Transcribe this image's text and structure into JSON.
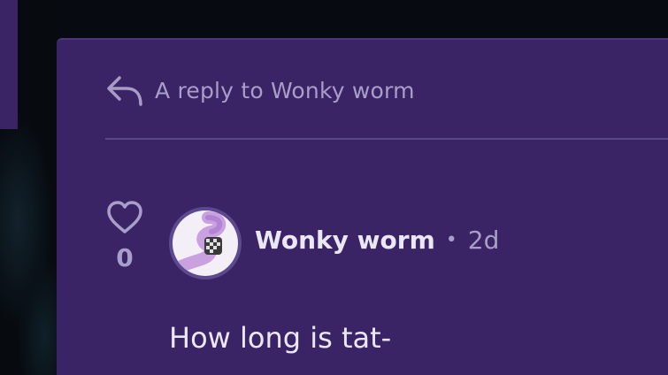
{
  "reply_header": {
    "icon": "reply-arrow-icon",
    "text": "A reply to Wonky worm"
  },
  "comment": {
    "like_icon": "heart-outline-icon",
    "like_count": "0",
    "avatar_icon": "worm-avatar",
    "author": "Wonky worm",
    "separator": "•",
    "time": "2d",
    "body": "How long is tat-"
  },
  "colors": {
    "card_bg": "#3b2466",
    "muted_text": "#a99ec9",
    "primary_text": "#ece7f6"
  }
}
